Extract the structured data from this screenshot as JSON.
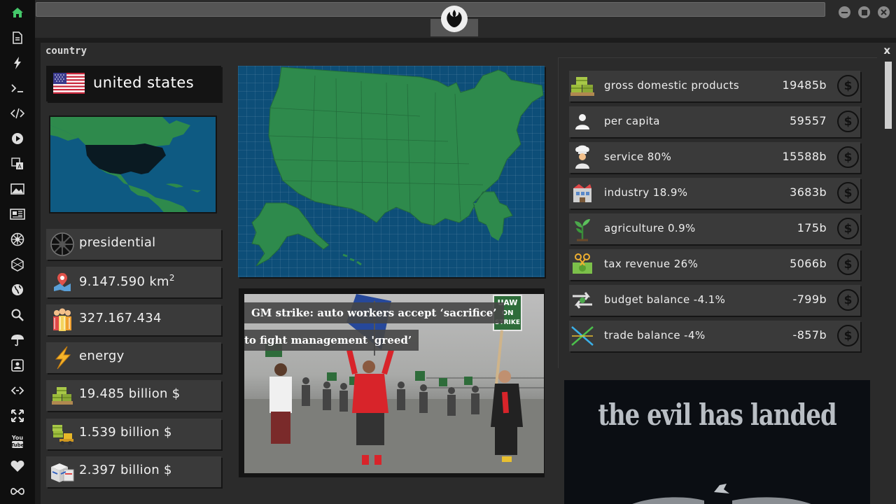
{
  "sidebar": {
    "items": [
      {
        "icon": "home-icon"
      },
      {
        "icon": "document-icon"
      },
      {
        "icon": "lightning-icon"
      },
      {
        "icon": "terminal-icon"
      },
      {
        "icon": "code-icon"
      },
      {
        "icon": "play-icon"
      },
      {
        "icon": "translate-icon"
      },
      {
        "icon": "image-icon"
      },
      {
        "icon": "news-icon"
      },
      {
        "icon": "empire-icon"
      },
      {
        "icon": "hexagon-icon"
      },
      {
        "icon": "globe-icon"
      },
      {
        "icon": "search-icon"
      },
      {
        "icon": "umbrella-icon"
      },
      {
        "icon": "contact-icon"
      },
      {
        "icon": "link-icon"
      },
      {
        "icon": "expand-icon"
      },
      {
        "icon": "youtube-icon"
      },
      {
        "icon": "heart-icon"
      },
      {
        "icon": "infinity-icon"
      }
    ]
  },
  "topbar": {
    "logo_icon": "rebel-alliance-icon"
  },
  "window": {
    "title": "country",
    "close_label": "x"
  },
  "country": {
    "name": "united states",
    "flag_icon": "us-flag-icon",
    "government": "presidential",
    "area": "9.147.590 km",
    "area_sup": "2",
    "population": "327.167.434",
    "energy_label": "energy",
    "money_1": "19.485 billion $",
    "money_2": "1.539 billion $",
    "money_3": "2.397 billion $"
  },
  "news": {
    "headline_line1": "GM strike: auto workers accept ‘sacrifice’",
    "headline_line2": "to fight management 'greed’",
    "sign_text_1": "UAW",
    "sign_text_2": "ON",
    "sign_text_3": "STRIKE"
  },
  "economy": {
    "rows": [
      {
        "icon": "money-pallet-icon",
        "label": "gross domestic products",
        "amount": "19485b"
      },
      {
        "icon": "person-icon",
        "label": "per capita",
        "amount": "59557"
      },
      {
        "icon": "chef-icon",
        "label": "service 80%",
        "amount": "15588b"
      },
      {
        "icon": "factory-icon",
        "label": "industry 18.9%",
        "amount": "3683b"
      },
      {
        "icon": "plant-icon",
        "label": "agriculture 0.9%",
        "amount": "175b"
      },
      {
        "icon": "money-cut-icon",
        "label": "tax revenue 26%",
        "amount": "5066b"
      },
      {
        "icon": "exchange-arrows-icon",
        "label": "budget balance -4.1%",
        "amount": "-799b"
      },
      {
        "icon": "trade-cross-icon",
        "label": "trade balance -4%",
        "amount": "-857b"
      }
    ],
    "coin_symbol": "$"
  },
  "promo": {
    "text": "the evil has landed"
  },
  "colors": {
    "active": "#45c86a",
    "land": "#2e8a4c",
    "sea": "#0d4e78",
    "card": "#3a3a3a"
  }
}
